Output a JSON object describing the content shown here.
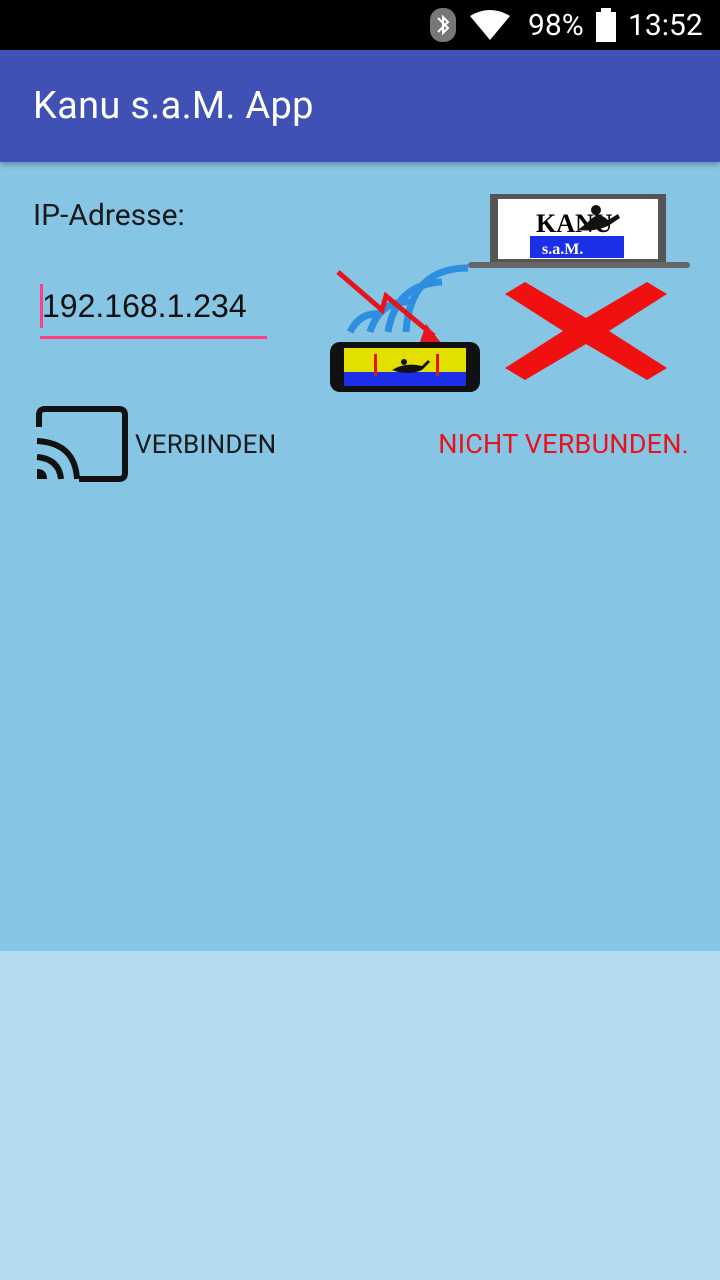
{
  "status_bar": {
    "icons": [
      "bluetooth-icon",
      "wifi-icon",
      "battery-icon"
    ],
    "battery": "98%",
    "time": "13:52"
  },
  "app_bar": {
    "title": "Kanu s.a.M. App"
  },
  "form": {
    "ip_label": "IP-Adresse:",
    "ip_value": "192.168.1.234"
  },
  "connect": {
    "label": "VERBINDEN",
    "icon": "cast-icon"
  },
  "connection_status": {
    "text": "NICHT VERBUNDEN.",
    "color": "#e8141c"
  },
  "illustration": {
    "laptop_logo": "KANU s.a.M.",
    "icons": [
      "laptop-icon",
      "wifi-signal-icon",
      "lightning-arrow-icon",
      "device-icon",
      "disconnected-x-icon"
    ]
  },
  "colors": {
    "app_bar": "#3f51b5",
    "content_bg": "#86c6e4",
    "lower_bg": "#b3dbed",
    "accent": "#ff4081"
  }
}
